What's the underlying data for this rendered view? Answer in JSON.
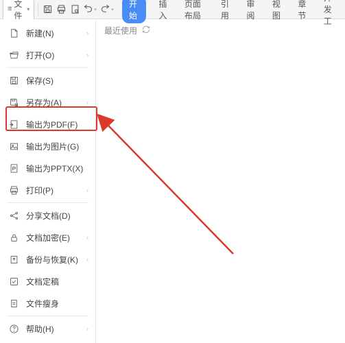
{
  "fileBtn": {
    "label": "文件"
  },
  "tabs": {
    "active": "开始",
    "items": [
      "插入",
      "页面布局",
      "引用",
      "审阅",
      "视图",
      "章节",
      "开发工"
    ]
  },
  "menu": {
    "items": [
      {
        "label": "新建(N)",
        "arrow": true
      },
      {
        "label": "打开(O)",
        "arrow": true
      },
      {
        "label": "保存(S)",
        "arrow": false
      },
      {
        "label": "另存为(A)",
        "arrow": true
      },
      {
        "label": "输出为PDF(F)",
        "arrow": false
      },
      {
        "label": "输出为图片(G)",
        "arrow": false
      },
      {
        "label": "输出为PPTX(X)",
        "arrow": false
      },
      {
        "label": "打印(P)",
        "arrow": true
      },
      {
        "label": "分享文档(D)",
        "arrow": false
      },
      {
        "label": "文档加密(E)",
        "arrow": true
      },
      {
        "label": "备份与恢复(K)",
        "arrow": true
      },
      {
        "label": "文档定稿",
        "arrow": false
      },
      {
        "label": "文件瘦身",
        "arrow": false
      },
      {
        "label": "帮助(H)",
        "arrow": true
      }
    ]
  },
  "rightPanel": {
    "recent": "最近使用"
  }
}
